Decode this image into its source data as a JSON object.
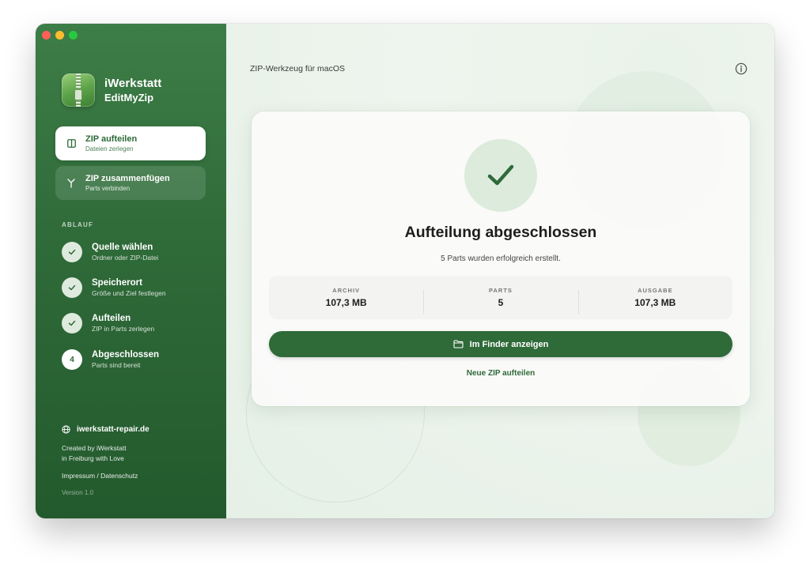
{
  "app": {
    "brand_name": "iWerkstatt",
    "product_name": "EditMyZip"
  },
  "sidebar": {
    "modes": [
      {
        "title": "ZIP aufteilen",
        "subtitle": "Dateien zerlegen",
        "active": true
      },
      {
        "title": "ZIP zusammenfügen",
        "subtitle": "Parts verbinden",
        "active": false
      }
    ],
    "section_heading": "ABLAUF",
    "steps": [
      {
        "title": "Quelle wählen",
        "subtitle": "Ordner oder ZIP-Datei",
        "state": "done"
      },
      {
        "title": "Speicherort",
        "subtitle": "Größe und Ziel festlegen",
        "state": "done"
      },
      {
        "title": "Aufteilen",
        "subtitle": "ZIP in Parts zerlegen",
        "state": "done"
      },
      {
        "title": "Abgeschlossen",
        "subtitle": "Parts sind bereit",
        "state": "current",
        "number": "4"
      }
    ],
    "website": "iwerkstatt-repair.de",
    "credit_line1": "Created by iWerkstatt",
    "credit_line2": "in Freiburg with Love",
    "legal": "Impressum / Datenschutz",
    "version": "Version 1.0"
  },
  "main": {
    "title": "ZIP-Werkzeug für macOS",
    "card": {
      "title": "Aufteilung abgeschlossen",
      "subtitle": "5 Parts wurden erfolgreich erstellt.",
      "stats": [
        {
          "label": "ARCHIV",
          "value": "107,3 MB"
        },
        {
          "label": "PARTS",
          "value": "5"
        },
        {
          "label": "AUSGABE",
          "value": "107,3 MB"
        }
      ],
      "primary_button": "Im Finder anzeigen",
      "secondary_link": "Neue ZIP aufteilen"
    }
  },
  "colors": {
    "brand_green": "#2f6a39",
    "sidebar_top": "#3d7d47",
    "sidebar_bottom": "#235a2d",
    "success_circle": "#dcebdc"
  },
  "icons": {
    "split_mode": "split-columns-icon",
    "merge_mode": "merge-arrows-icon",
    "step_done": "checkmark-icon",
    "website": "globe-icon",
    "info": "info-circle-icon",
    "success": "large-checkmark-icon",
    "finder": "folder-icon"
  }
}
